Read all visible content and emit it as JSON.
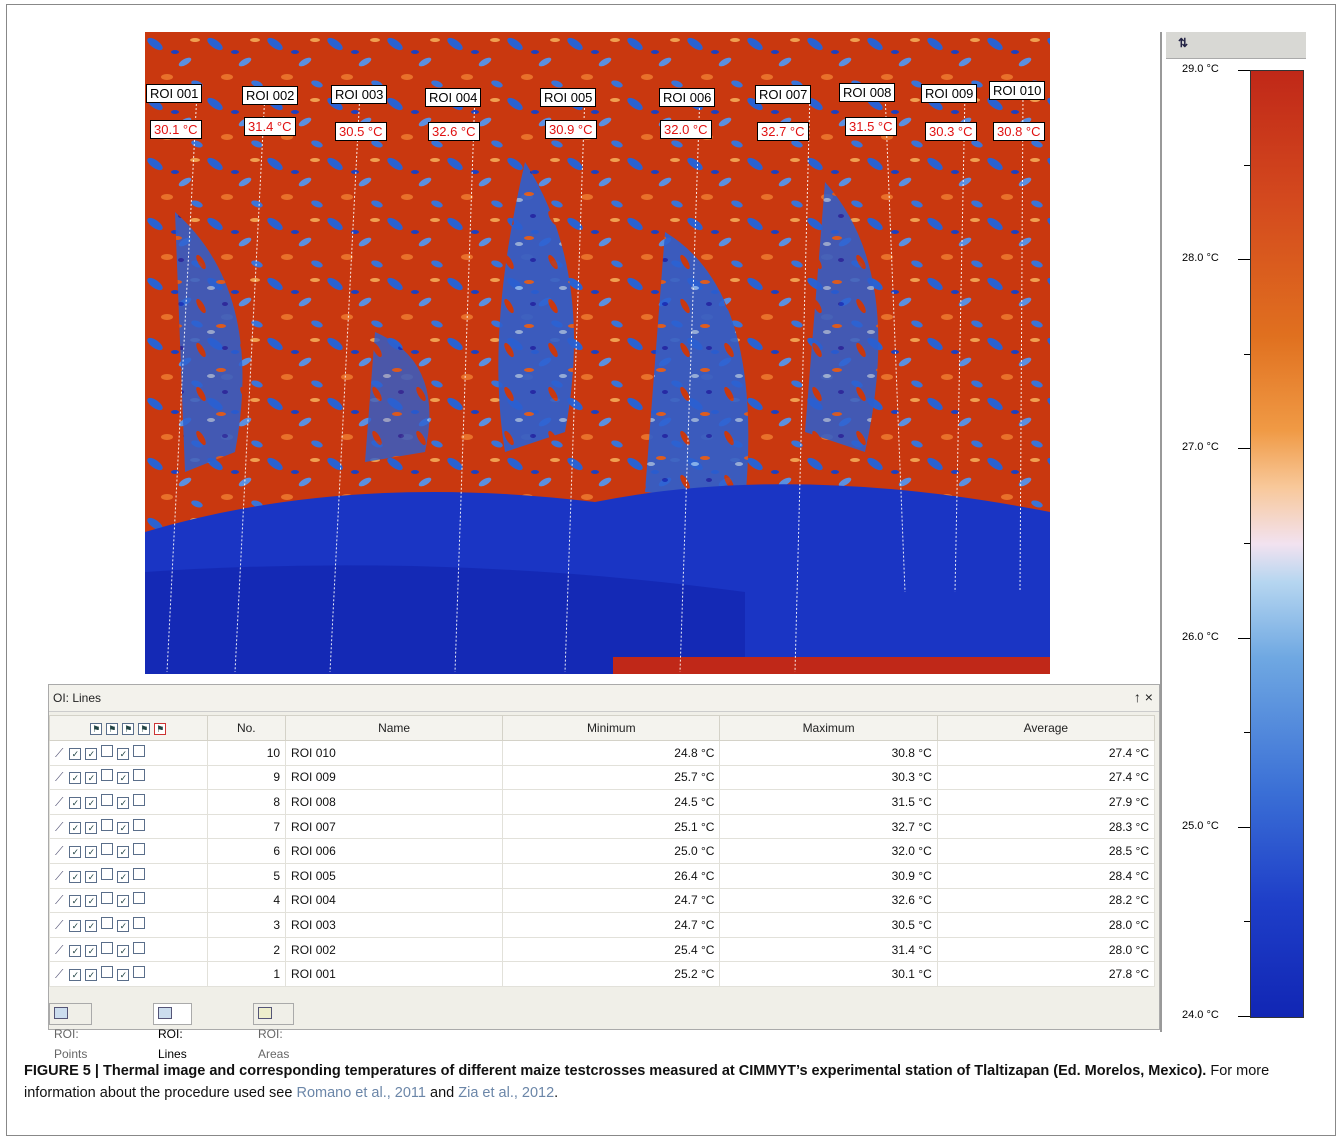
{
  "thermal": {
    "rois": [
      {
        "label": "ROI 001",
        "temp": "30.1 °C"
      },
      {
        "label": "ROI 002",
        "temp": "31.4 °C"
      },
      {
        "label": "ROI 003",
        "temp": "30.5 °C"
      },
      {
        "label": "ROI 004",
        "temp": "32.6 °C"
      },
      {
        "label": "ROI 005",
        "temp": "30.9 °C"
      },
      {
        "label": "ROI 006",
        "temp": "32.0 °C"
      },
      {
        "label": "ROI 007",
        "temp": "32.7 °C"
      },
      {
        "label": "ROI 008",
        "temp": "31.5 °C"
      },
      {
        "label": "ROI 009",
        "temp": "30.3 °C"
      },
      {
        "label": "ROI 010",
        "temp": "30.8 °C"
      }
    ]
  },
  "scale": {
    "ticks": [
      "29.0 °C",
      "28.0 °C",
      "27.0 °C",
      "26.0 °C",
      "25.0 °C",
      "24.0 °C"
    ],
    "colors": {
      "hot": "#c02818",
      "mid": "#f2e2f0",
      "cold": "#1126b4"
    }
  },
  "panel": {
    "title": "OI: Lines",
    "controls": "↑ ×",
    "columns": [
      "No.",
      "Name",
      "Minimum",
      "Maximum",
      "Average"
    ],
    "rows": [
      {
        "no": "10",
        "name": "ROI 010",
        "min": "24.8 °C",
        "max": "30.8 °C",
        "avg": "27.4 °C"
      },
      {
        "no": "9",
        "name": "ROI 009",
        "min": "25.7 °C",
        "max": "30.3 °C",
        "avg": "27.4 °C"
      },
      {
        "no": "8",
        "name": "ROI 008",
        "min": "24.5 °C",
        "max": "31.5 °C",
        "avg": "27.9 °C"
      },
      {
        "no": "7",
        "name": "ROI 007",
        "min": "25.1 °C",
        "max": "32.7 °C",
        "avg": "28.3 °C"
      },
      {
        "no": "6",
        "name": "ROI 006",
        "min": "25.0 °C",
        "max": "32.0 °C",
        "avg": "28.5 °C"
      },
      {
        "no": "5",
        "name": "ROI 005",
        "min": "26.4 °C",
        "max": "30.9 °C",
        "avg": "28.4 °C"
      },
      {
        "no": "4",
        "name": "ROI 004",
        "min": "24.7 °C",
        "max": "32.6 °C",
        "avg": "28.2 °C"
      },
      {
        "no": "3",
        "name": "ROI 003",
        "min": "24.7 °C",
        "max": "30.5 °C",
        "avg": "28.0 °C"
      },
      {
        "no": "2",
        "name": "ROI 002",
        "min": "25.4 °C",
        "max": "31.4 °C",
        "avg": "28.0 °C"
      },
      {
        "no": "1",
        "name": "ROI 001",
        "min": "25.2 °C",
        "max": "30.1 °C",
        "avg": "27.8 °C"
      }
    ],
    "tabs": [
      "ROI: Points",
      "ROI: Lines",
      "ROI: Areas"
    ]
  },
  "caption": {
    "bold": "FIGURE 5 | Thermal image and corresponding temperatures of different maize testcrosses measured at CIMMYT’s experimental station of Tlaltizapan (Ed. Morelos, Mexico).",
    "text1": " For more information about the procedure used see ",
    "ref1": "Romano et al., 2011",
    "text2": " and ",
    "ref2": "Zia et al., 2012",
    "text3": "."
  }
}
